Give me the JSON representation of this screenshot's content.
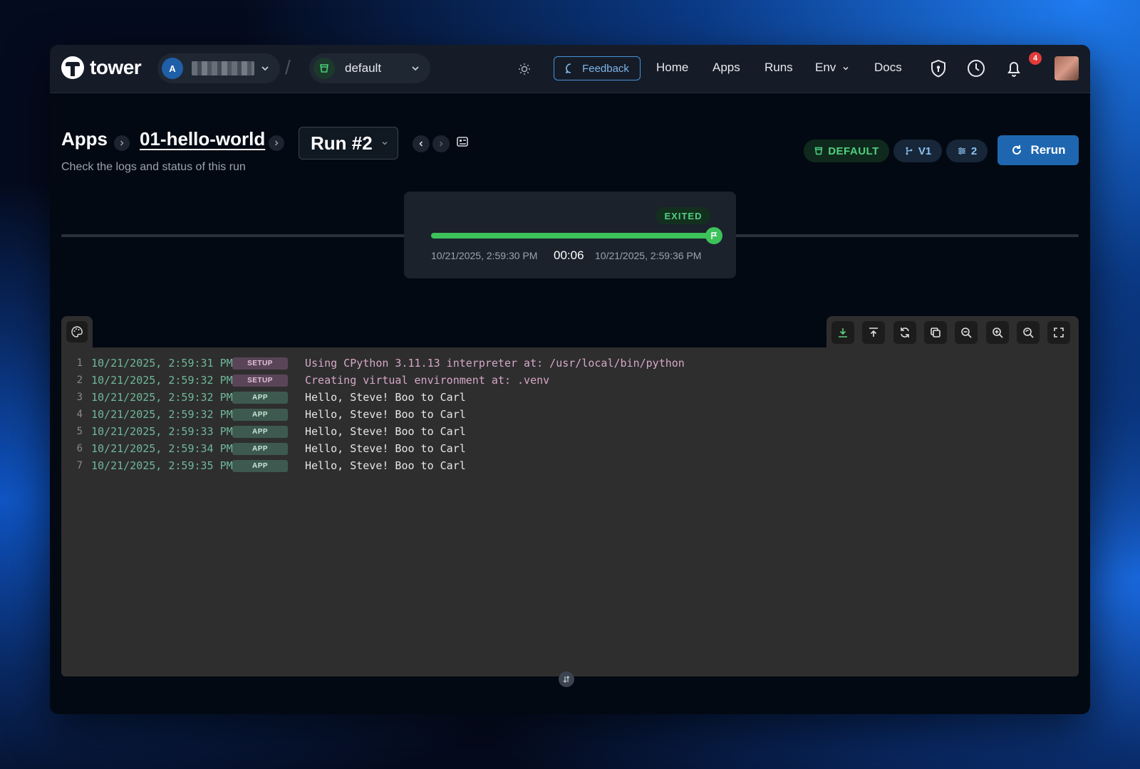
{
  "brand": {
    "name": "tower"
  },
  "account": {
    "initial": "A"
  },
  "environment": {
    "name": "default"
  },
  "nav": {
    "feedback_label": "Feedback",
    "links": [
      "Home",
      "Apps",
      "Runs",
      "Env",
      "Docs"
    ],
    "notification_count": "4"
  },
  "breadcrumb": {
    "apps": "Apps",
    "app_name": "01-hello-world",
    "run": "Run #2"
  },
  "subtitle": "Check the logs and status of this run",
  "badges": {
    "environment": "DEFAULT",
    "version": "V1",
    "params": "2"
  },
  "rerun_label": "Rerun",
  "timeline": {
    "status": "EXITED",
    "start": "10/21/2025, 2:59:30 PM",
    "duration": "00:06",
    "end": "10/21/2025, 2:59:36 PM",
    "progress": 1.0
  },
  "logs": [
    {
      "n": "1",
      "ts": "10/21/2025, 2:59:31 PM",
      "tag": "SETUP",
      "msg": "Using CPython 3.11.13 interpreter at: /usr/local/bin/python"
    },
    {
      "n": "2",
      "ts": "10/21/2025, 2:59:32 PM",
      "tag": "SETUP",
      "msg": "Creating virtual environment at: .venv"
    },
    {
      "n": "3",
      "ts": "10/21/2025, 2:59:32 PM",
      "tag": "APP",
      "msg": "Hello, Steve! Boo to Carl"
    },
    {
      "n": "4",
      "ts": "10/21/2025, 2:59:32 PM",
      "tag": "APP",
      "msg": "Hello, Steve! Boo to Carl"
    },
    {
      "n": "5",
      "ts": "10/21/2025, 2:59:33 PM",
      "tag": "APP",
      "msg": "Hello, Steve! Boo to Carl"
    },
    {
      "n": "6",
      "ts": "10/21/2025, 2:59:34 PM",
      "tag": "APP",
      "msg": "Hello, Steve! Boo to Carl"
    },
    {
      "n": "7",
      "ts": "10/21/2025, 2:59:35 PM",
      "tag": "APP",
      "msg": "Hello, Steve! Boo to Carl"
    }
  ],
  "toolbar_icons": [
    "download-icon",
    "scroll-top-icon",
    "refresh-icon",
    "copy-icon",
    "zoom-out-icon",
    "zoom-in-icon",
    "zoom-reset-icon",
    "fullscreen-icon"
  ],
  "colors": {
    "accent": "#1e67b0",
    "success": "#3cc15b",
    "log_timestamp": "#6fb79a",
    "setup_text": "#d6a8c8"
  }
}
